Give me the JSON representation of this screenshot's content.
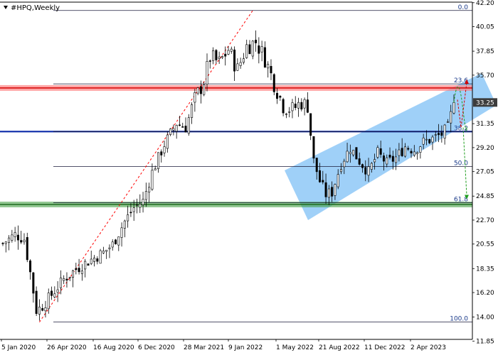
{
  "window": {
    "title": "#HPQ,Weekly",
    "collapse_icon": "triangle-down-icon"
  },
  "colors": {
    "background": "#ffffff",
    "frame": "#000000",
    "bull_candle": "#ffffff",
    "bear_candle": "#000000",
    "resistance_band": "#ff8080",
    "resistance_line": "#d40000",
    "support_line": "#0a2aa8",
    "support_band": "#3a9a3a",
    "channel_fill": "#7fc0f5",
    "fib_line": "#1a1a3a",
    "trend_dashed": "#ff0000",
    "forecast_green": "#1e9e1e",
    "forecast_red": "#d40000",
    "price_label_bg": "#3c3c3c"
  },
  "chart_data": {
    "type": "candlestick",
    "title": "#HPQ,Weekly",
    "ylim": [
      12.0,
      42.25
    ],
    "y_ticks": [
      "42.20",
      "40.05",
      "37.85",
      "35.70",
      "33.25",
      "31.35",
      "29.20",
      "27.05",
      "24.85",
      "22.70",
      "20.55",
      "18.35",
      "16.20",
      "14.00",
      "11.85"
    ],
    "x_tick_labels": [
      "5 Jan 2020",
      "26 Apr 2020",
      "16 Aug 2020",
      "6 Dec 2020",
      "28 Mar 2021",
      "9 Jan 2022",
      "1 May 2022",
      "21 Aug 2022",
      "11 Dec 2022",
      "2 Apr 2023"
    ],
    "current_price": "33.25",
    "horizontal_levels": {
      "resistance": 34.55,
      "support_blue": 30.64,
      "support_green": 24.1
    },
    "fibonacci": [
      {
        "label": "0.0",
        "price": 41.5
      },
      {
        "label": "23.6",
        "price": 34.92
      },
      {
        "label": "38.2",
        "price": 30.64
      },
      {
        "label": "50.0",
        "price": 27.5
      },
      {
        "label": "61.8",
        "price": 24.25
      },
      {
        "label": "100.0",
        "price": 13.55
      }
    ],
    "trend_line": {
      "from": {
        "index": 12,
        "price": 13.55
      },
      "to": {
        "index": 82,
        "price": 41.5
      }
    },
    "forecast": {
      "up_to": 35.0,
      "down_to": 24.9
    },
    "ohlc": []
  }
}
